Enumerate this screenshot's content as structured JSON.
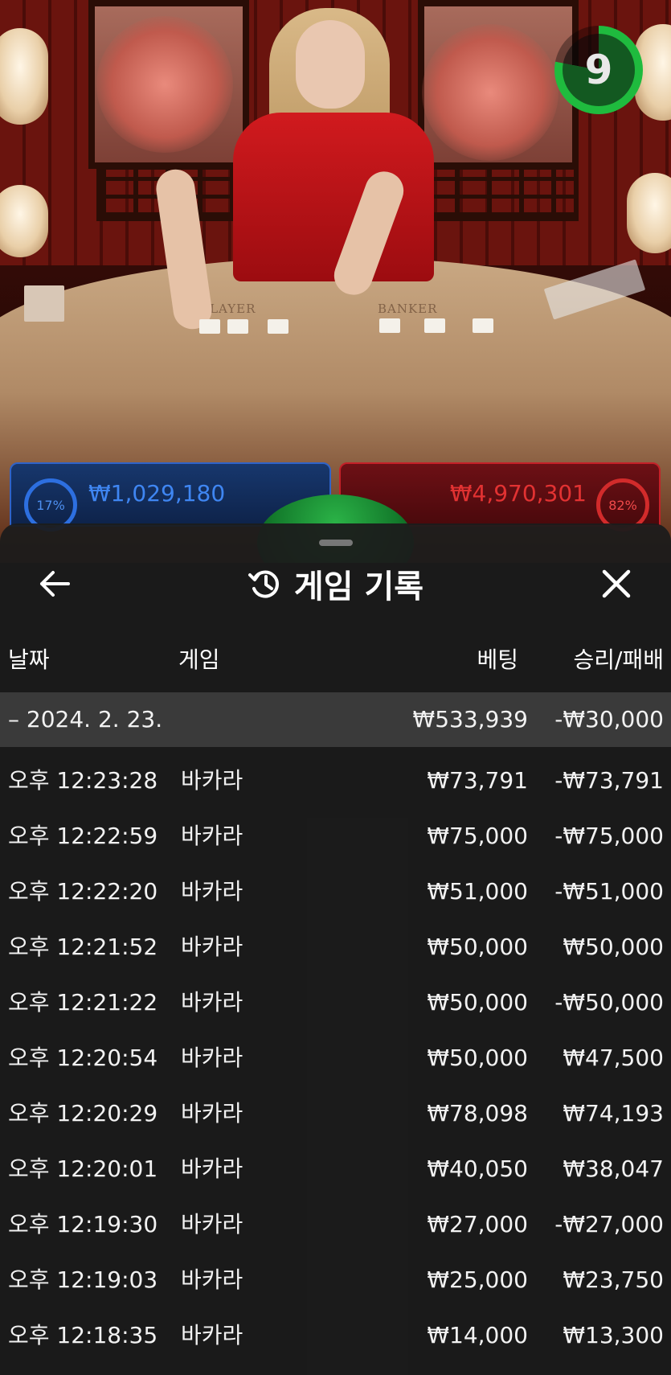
{
  "video": {
    "timer_value": "9",
    "zone_player": "PLAYER",
    "zone_banker": "BANKER",
    "player_bet": {
      "percent": "17%",
      "amount": "₩1,029,180"
    },
    "banker_bet": {
      "percent": "82%",
      "amount": "₩4,970,301"
    }
  },
  "sheet": {
    "title": "게임 기록",
    "icons": {
      "back": "arrow-left-icon",
      "history": "history-icon",
      "close": "close-icon"
    },
    "columns": {
      "date": "날짜",
      "game": "게임",
      "bet": "베팅",
      "result": "승리/패배"
    },
    "date_group": {
      "date": "– 2024. 2. 23.",
      "bet": "₩533,939",
      "result": "-₩30,000"
    },
    "rows": [
      {
        "time": "오후 12:23:28",
        "game": "바카라",
        "bet": "₩73,791",
        "result": "-₩73,791"
      },
      {
        "time": "오후 12:22:59",
        "game": "바카라",
        "bet": "₩75,000",
        "result": "-₩75,000"
      },
      {
        "time": "오후 12:22:20",
        "game": "바카라",
        "bet": "₩51,000",
        "result": "-₩51,000"
      },
      {
        "time": "오후 12:21:52",
        "game": "바카라",
        "bet": "₩50,000",
        "result": "₩50,000"
      },
      {
        "time": "오후 12:21:22",
        "game": "바카라",
        "bet": "₩50,000",
        "result": "-₩50,000"
      },
      {
        "time": "오후 12:20:54",
        "game": "바카라",
        "bet": "₩50,000",
        "result": "₩47,500"
      },
      {
        "time": "오후 12:20:29",
        "game": "바카라",
        "bet": "₩78,098",
        "result": "₩74,193"
      },
      {
        "time": "오후 12:20:01",
        "game": "바카라",
        "bet": "₩40,050",
        "result": "₩38,047"
      },
      {
        "time": "오후 12:19:30",
        "game": "바카라",
        "bet": "₩27,000",
        "result": "-₩27,000"
      },
      {
        "time": "오후 12:19:03",
        "game": "바카라",
        "bet": "₩25,000",
        "result": "₩23,750"
      },
      {
        "time": "오후 12:18:35",
        "game": "바카라",
        "bet": "₩14,000",
        "result": "₩13,300"
      }
    ]
  }
}
